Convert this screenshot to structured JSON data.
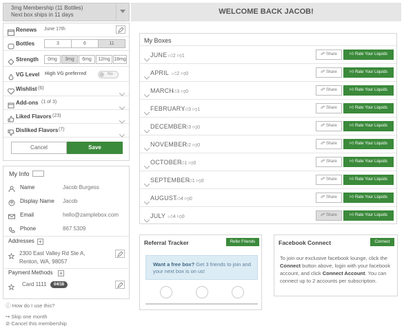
{
  "membership": {
    "line1": "3mg Membership (11 Bottles)",
    "line2": "Next box ships in 11 days"
  },
  "welcome": "WELCOME BACK JACOB!",
  "settings": {
    "renews_label": "Renews",
    "renews_value": "June 17th",
    "bottles_label": "Bottles",
    "bottles_options": [
      "3",
      "6",
      "11"
    ],
    "bottles_selected": "11",
    "strength_label": "Strength",
    "strength_options": [
      "0mg",
      "3mg",
      "6mg",
      "12mg",
      "18mg"
    ],
    "strength_selected": "3mg",
    "vg_label": "VG Level",
    "vg_value": "High VG preferred",
    "vg_toggle": "No",
    "wishlist_label": "Wishlist",
    "wishlist_count": "(6)",
    "addons_label": "Add-ons",
    "addons_count": "(1 of 3)",
    "liked_label": "Liked Flavors",
    "liked_count": "(23)",
    "disliked_label": "Disliked Flavors",
    "disliked_count": "(7)",
    "cancel": "Cancel",
    "save": "Save"
  },
  "myinfo": {
    "title": "My Info",
    "fields": [
      {
        "label": "Name",
        "value": "Jacob Burgess",
        "icon": "person-icon"
      },
      {
        "label": "Display Name",
        "value": "Jacob",
        "icon": "id-card-icon"
      },
      {
        "label": "Email",
        "value": "hello@zamplebox.com",
        "icon": "mail-icon"
      },
      {
        "label": "Phone",
        "value": "867 5309",
        "icon": "phone-icon"
      }
    ],
    "addresses_label": "Addresses",
    "address_line1": "2300 East Valley Rd Ste A,",
    "address_line2": "Renton, WA, 98057",
    "payment_label": "Payment Methods",
    "card_label": "Card 1111",
    "card_exp": "04/18"
  },
  "footer": {
    "how": "How do I use this?",
    "skip": "Skip one month",
    "cancel": "Cancel this membership"
  },
  "boxes": {
    "title": "My Boxes",
    "share_label": "Share",
    "rate_label": "Rate Your Liquids",
    "rows": [
      {
        "month": "JUNE",
        "up": "2",
        "down": "1"
      },
      {
        "month": "APRIL",
        "up": "2",
        "down": "0"
      },
      {
        "month": "MARCH",
        "up": "3",
        "down": "0"
      },
      {
        "month": "FEBRUARY",
        "up": "3",
        "down": "1"
      },
      {
        "month": "DECEMBER",
        "up": "3",
        "down": "0"
      },
      {
        "month": "NOVEMBER",
        "up": "2",
        "down": "0"
      },
      {
        "month": "OCTOBER",
        "up": "1",
        "down": "0"
      },
      {
        "month": "SEPTEMBER",
        "up": "1",
        "down": "0"
      },
      {
        "month": "AUGUST",
        "up": "4",
        "down": "0"
      },
      {
        "month": "JULY",
        "up": "4",
        "down": "0"
      }
    ]
  },
  "referral": {
    "title": "Referral Tracker",
    "button": "Refer Friends",
    "lead": "Want a free box?",
    "text": " Get 3 friends to join and your next box is on us!"
  },
  "facebook": {
    "title": "Facebook Connect",
    "button": "Connect",
    "t1": "To join our exclusive facebook lounge, click the ",
    "b1": "Connect",
    "t2": " button above, login with your facebook account, and click ",
    "b2": "Connect Account",
    "t3": ". You can connect up to 2 accounts per subscription."
  },
  "colors": {
    "accent_green": "#3b8a3b",
    "header_grey": "#e6e6e6",
    "info_blue_bg": "#dcecf5"
  }
}
